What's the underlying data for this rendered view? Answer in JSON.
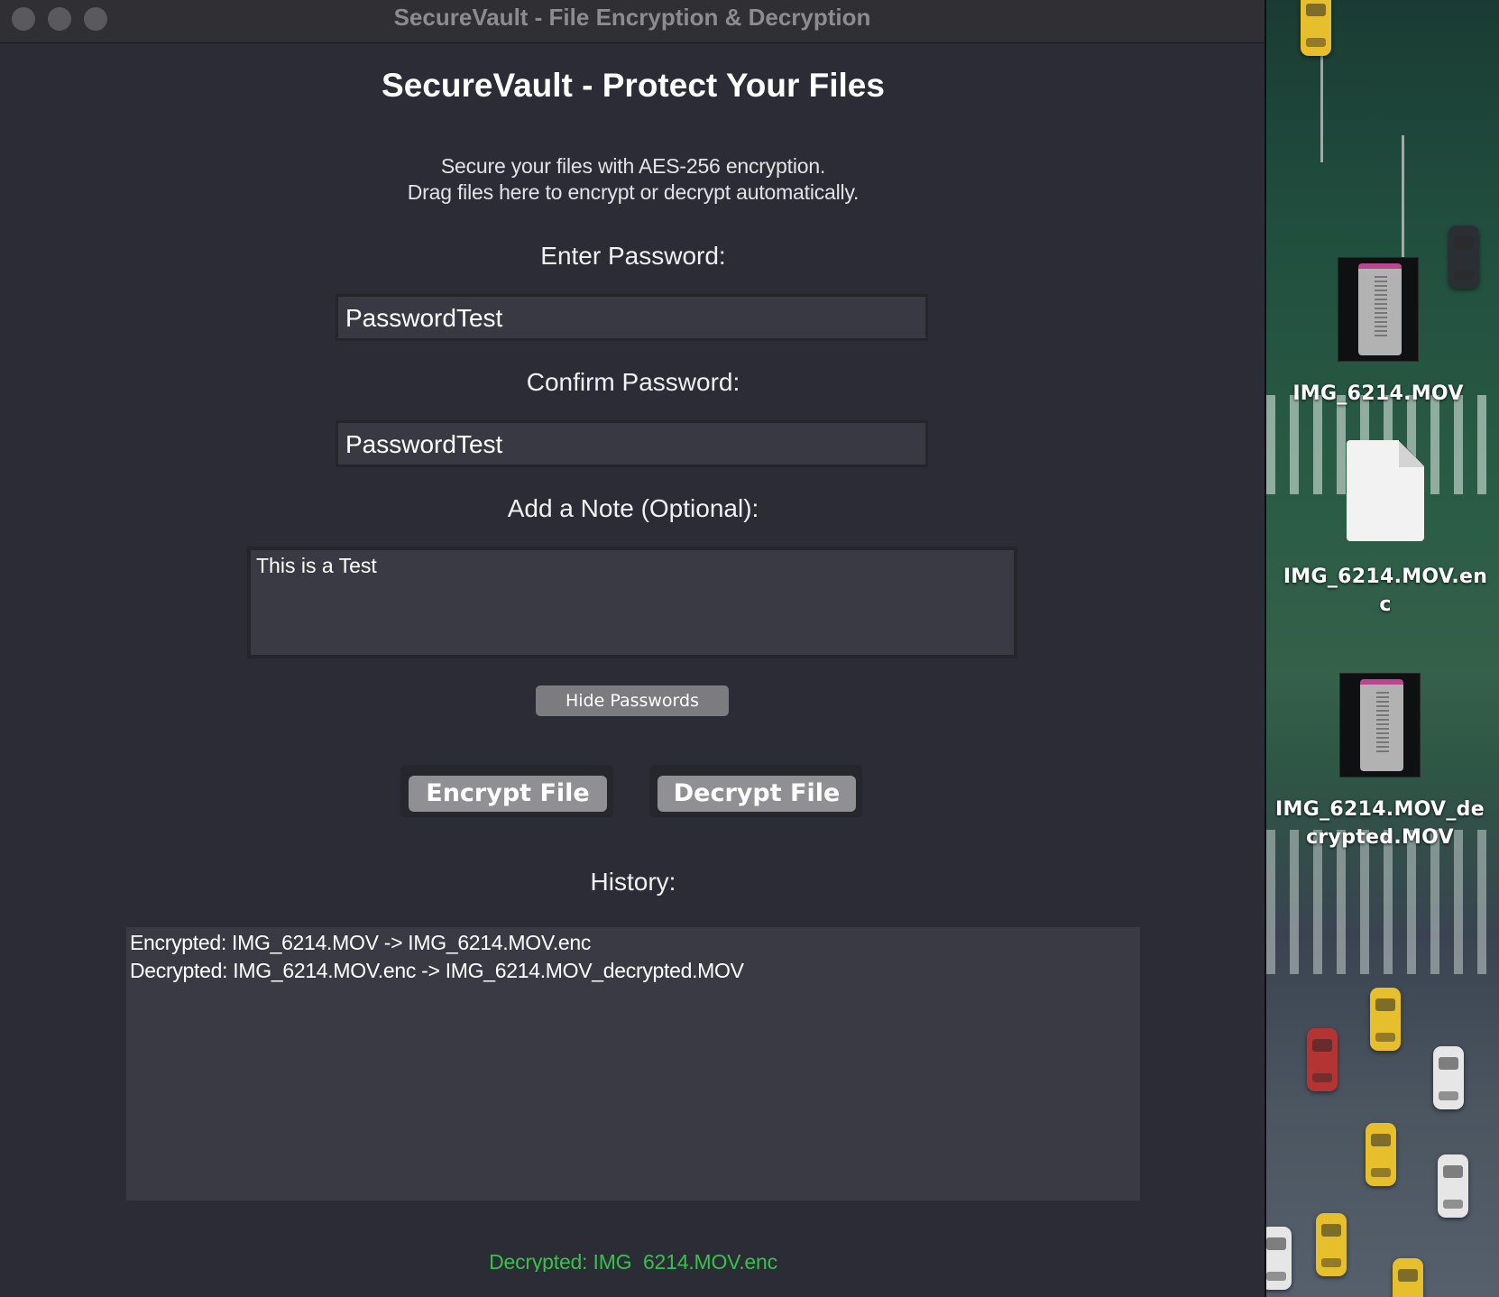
{
  "window": {
    "title": "SecureVault - File Encryption & Decryption"
  },
  "app": {
    "title": "SecureVault - Protect Your Files",
    "subtitle_line1": "Secure your files with AES-256 encryption.",
    "subtitle_line2": "Drag files here to encrypt or decrypt automatically."
  },
  "form": {
    "password_label": "Enter Password:",
    "password_value": "PasswordTest",
    "confirm_label": "Confirm Password:",
    "confirm_value": "PasswordTest",
    "note_label": "Add a Note (Optional):",
    "note_value": "This is a Test",
    "toggle_button": "Hide Passwords",
    "encrypt_button": "Encrypt File",
    "decrypt_button": "Decrypt File"
  },
  "history": {
    "label": "History:",
    "entries": [
      "Encrypted: IMG_6214.MOV -> IMG_6214.MOV.enc",
      "Decrypted: IMG_6214.MOV.enc -> IMG_6214.MOV_decrypted.MOV"
    ]
  },
  "status": {
    "text": "Decrypted: IMG_6214.MOV.enc",
    "color": "#36c24a"
  },
  "desktop": {
    "icons": [
      {
        "label": "IMG_6214.MOV",
        "icon": "video-thumbnail-icon"
      },
      {
        "label": "IMG_6214.MOV.enc",
        "icon": "generic-document-icon"
      },
      {
        "label": "IMG_6214.MOV_decrypted.MOV",
        "icon": "video-thumbnail-icon"
      }
    ]
  }
}
